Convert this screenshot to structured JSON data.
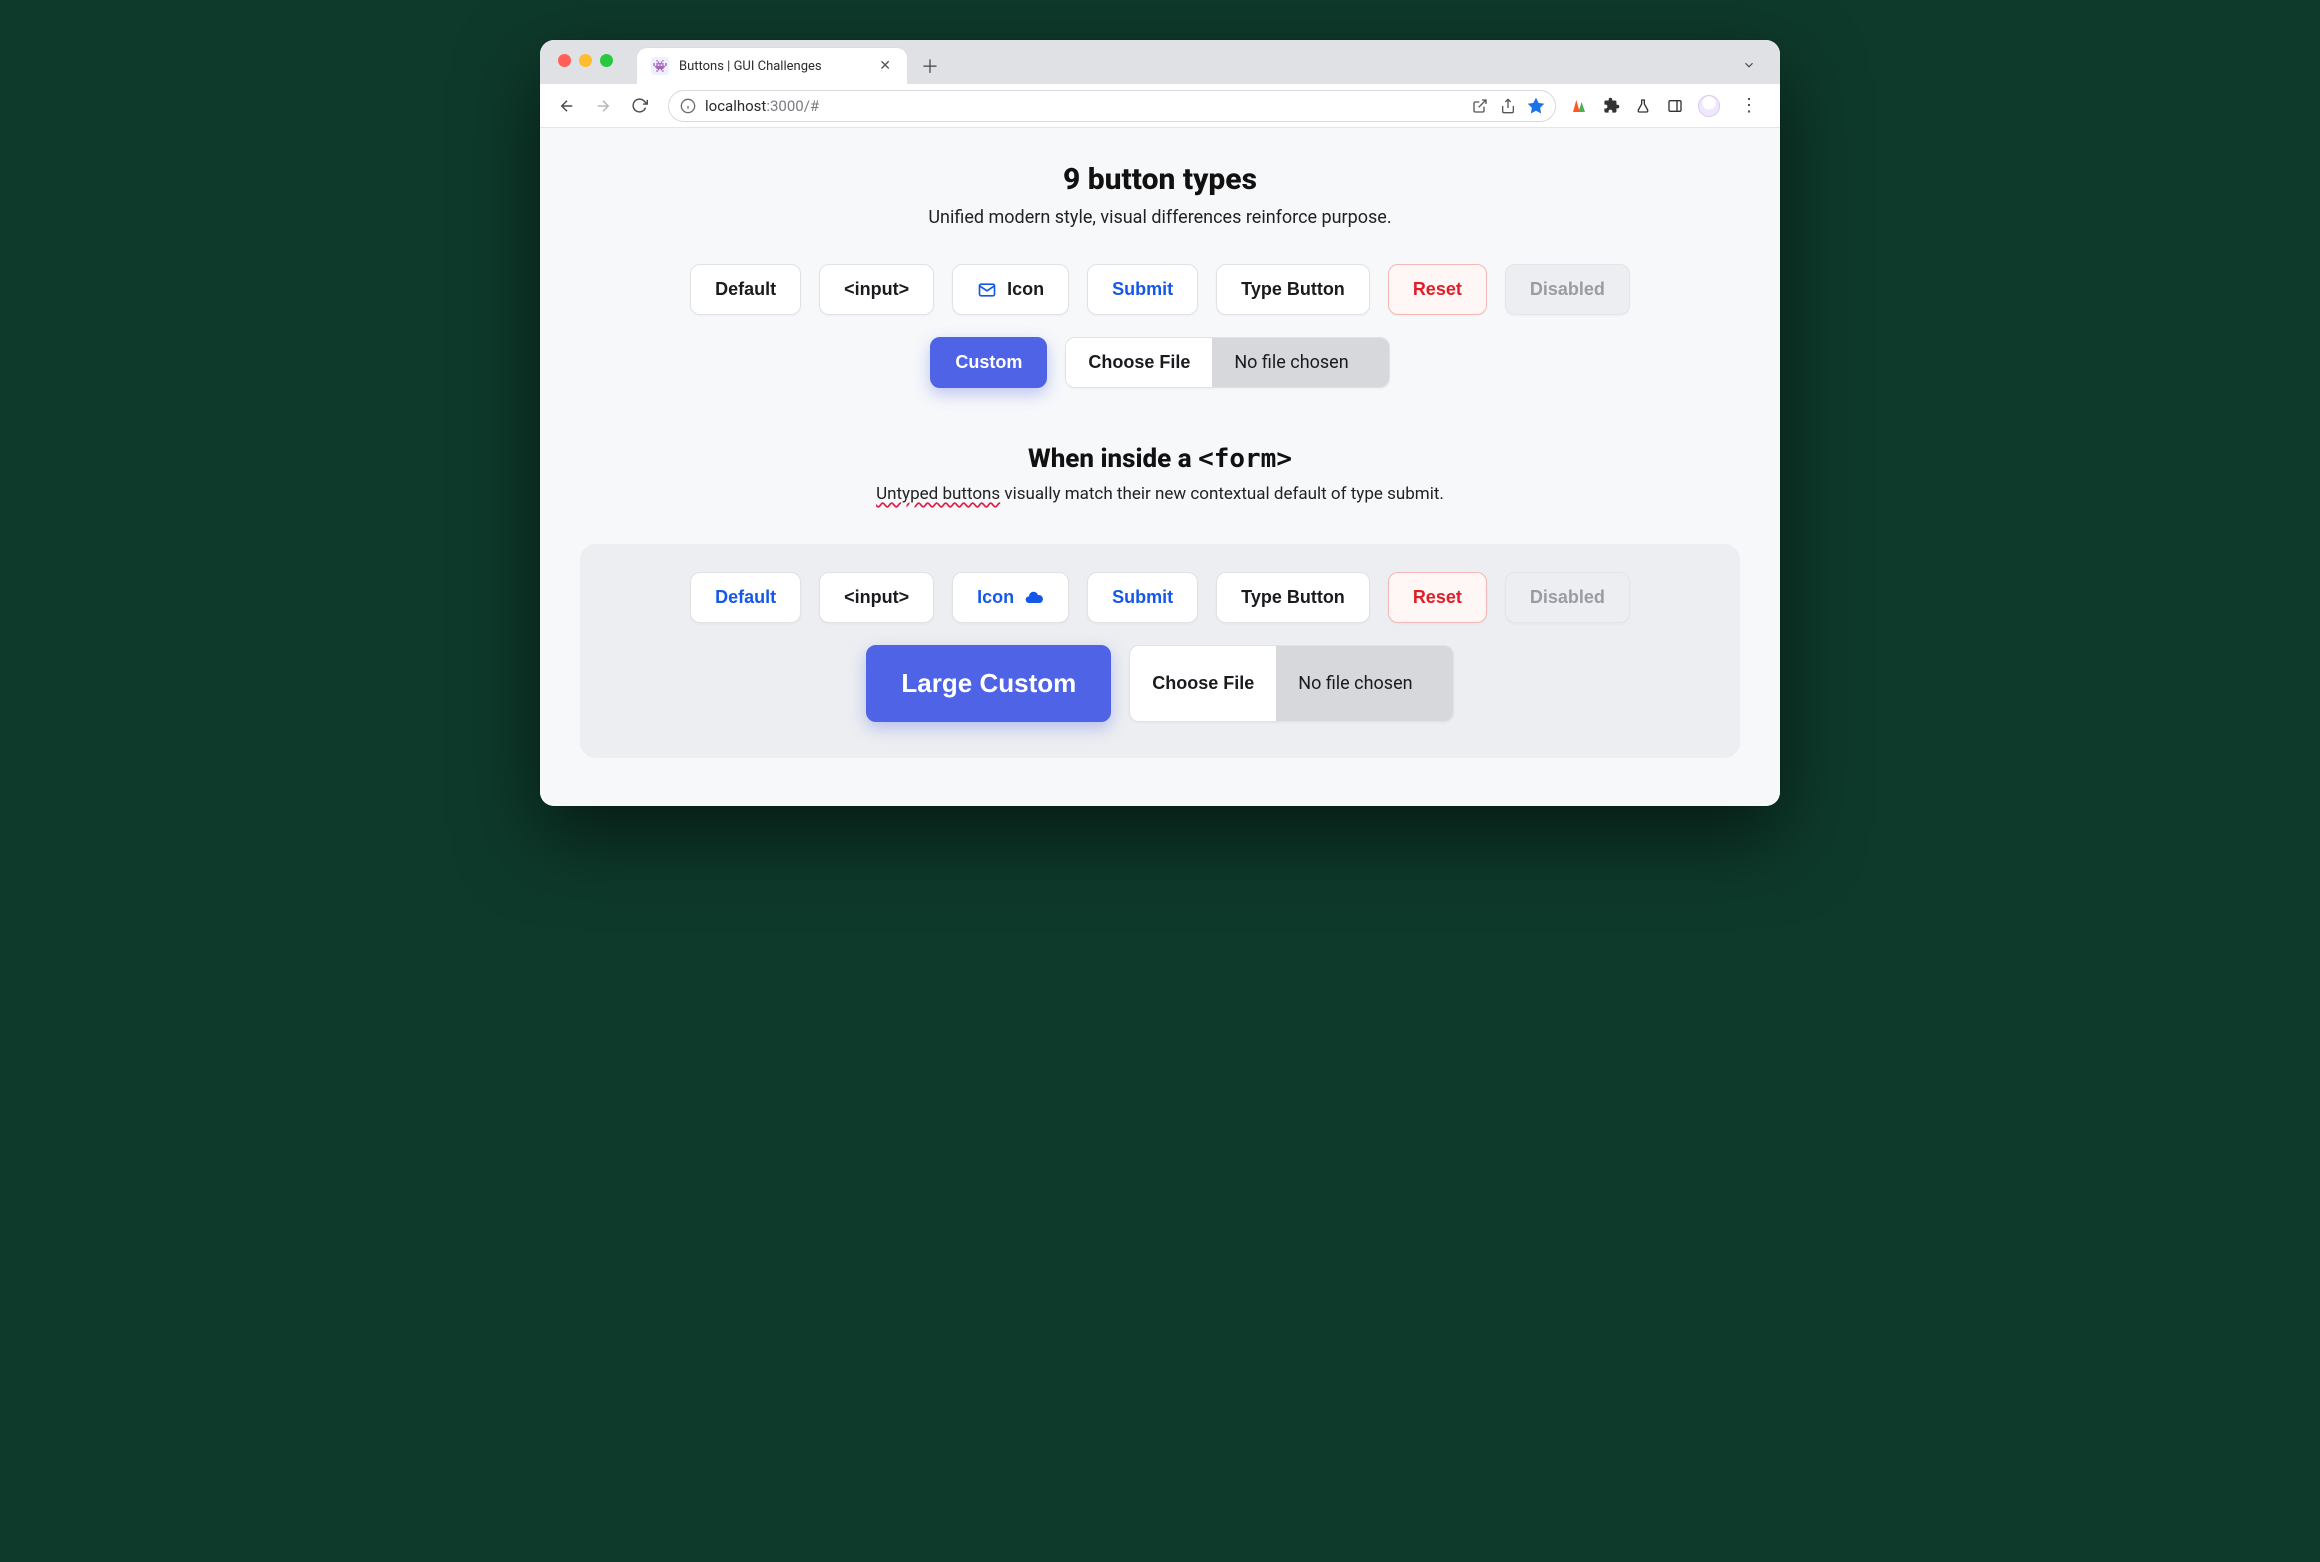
{
  "browser": {
    "tab_title": "Buttons | GUI Challenges",
    "url": {
      "host": "localhost",
      "port": ":3000",
      "path": "/#"
    }
  },
  "section1": {
    "heading": "9 button types",
    "subtitle": "Unified modern style, visual differences reinforce purpose.",
    "buttons": {
      "default": "Default",
      "input": "<input>",
      "icon": "Icon",
      "submit": "Submit",
      "type_button": "Type Button",
      "reset": "Reset",
      "disabled": "Disabled",
      "custom": "Custom",
      "choose_file": "Choose File",
      "file_status": "No file chosen"
    }
  },
  "section2": {
    "heading_prefix": "When inside a ",
    "heading_code": "<form>",
    "subtitle_emphasis": "Untyped buttons",
    "subtitle_rest": " visually match their new contextual default of type submit.",
    "buttons": {
      "default": "Default",
      "input": "<input>",
      "icon": "Icon",
      "submit": "Submit",
      "type_button": "Type Button",
      "reset": "Reset",
      "disabled": "Disabled",
      "custom": "Large Custom",
      "choose_file": "Choose File",
      "file_status": "No file chosen"
    }
  }
}
